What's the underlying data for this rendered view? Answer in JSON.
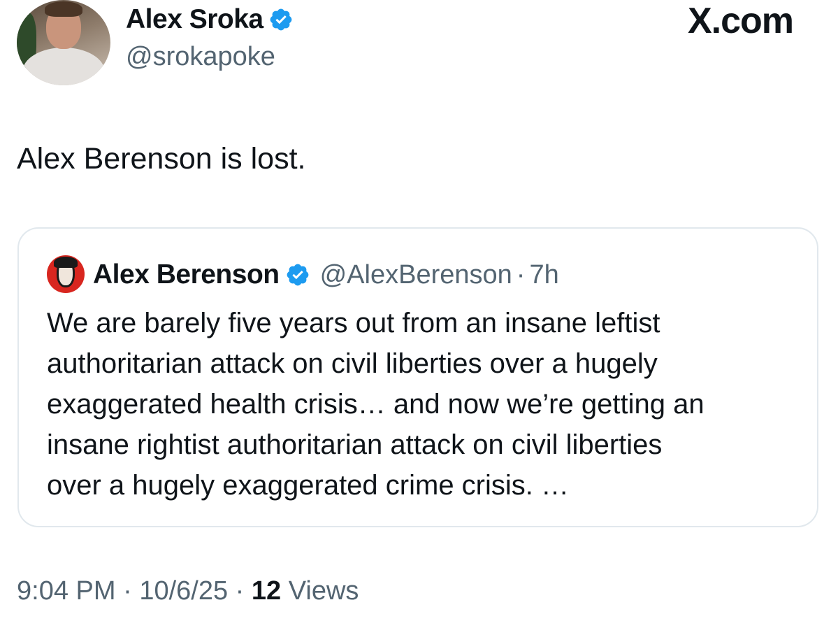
{
  "author": {
    "name": "Alex Sroka",
    "handle": "@srokapoke",
    "verified": true,
    "verified_color": "#1d9bf0"
  },
  "site_label": "X.com",
  "tweet_text": "Alex Berenson is lost.",
  "quote": {
    "name": "Alex Berenson",
    "handle": "@AlexBerenson",
    "separator": "·",
    "time": "7h",
    "verified": true,
    "text_lines": [
      "We are barely five years out from an insane leftist",
      "authoritarian attack on civil liberties over a hugely",
      "exaggerated health crisis… and now we’re getting an",
      "insane rightist authoritarian attack on civil liberties",
      "over a hugely exaggerated crime crisis. …"
    ]
  },
  "meta": {
    "time": "9:04 PM",
    "separator": " · ",
    "date": "10/6/25",
    "views_count": "12",
    "views_label": " Views"
  },
  "colors": {
    "text_primary": "#0f1419",
    "text_secondary": "#536471",
    "border": "#e1e8ed",
    "verified": "#1d9bf0"
  },
  "icons": {
    "verified": "verified-badge-icon",
    "brand": "x-logo"
  }
}
